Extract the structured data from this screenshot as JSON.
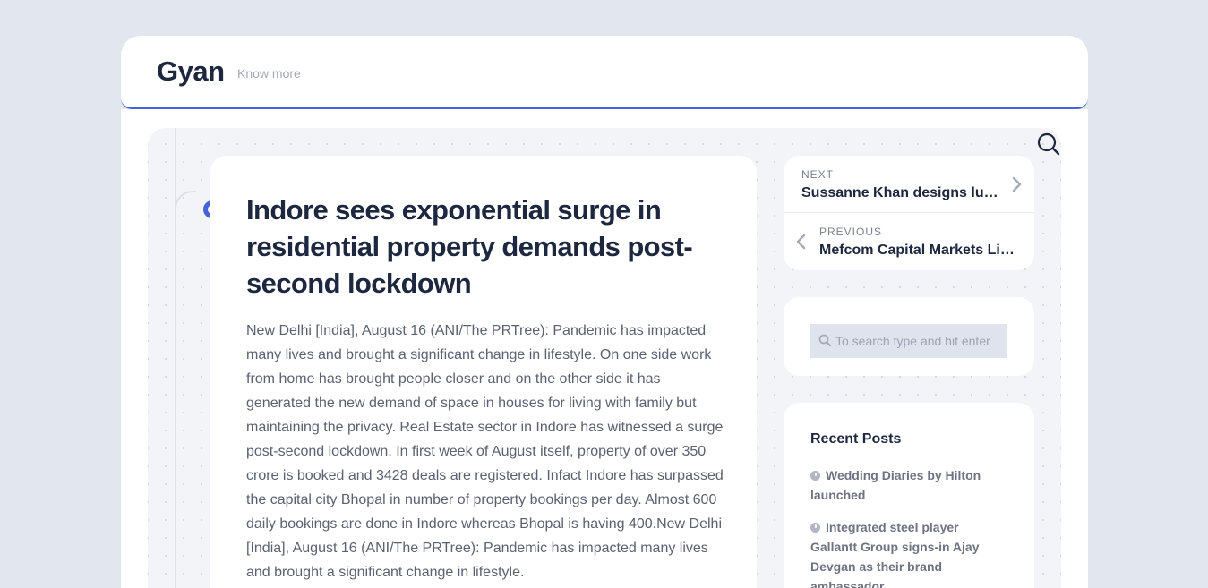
{
  "header": {
    "site_title": "Gyan",
    "tagline": "Know more"
  },
  "article": {
    "title": "Indore sees exponential surge in residential property demands post-second lockdown",
    "body": "New Delhi [India], August 16 (ANI/The PRTree): Pandemic has impacted many lives and brought a significant change in lifestyle. On one side work from home has brought people closer and on the other side it has generated the new demand of space in houses for living with family but maintaining the privacy. Real Estate sector in Indore has witnessed a surge post-second lockdown. In first week of August itself, property of over 350 crore is booked and 3428 deals are registered. Infact Indore has surpassed the capital city Bhopal in number of property bookings per day. Almost 600 daily bookings are done in Indore whereas Bhopal is having 400.New Delhi [India], August 16 (ANI/The PRTree): Pandemic has impacted many lives and brought a significant change in lifestyle."
  },
  "post_nav": {
    "next_kicker": "NEXT",
    "next_title": "Sussanne Khan designs luxury home",
    "prev_kicker": "PREVIOUS",
    "prev_title": "Mefcom Capital Markets Limited"
  },
  "search": {
    "placeholder": "To search type and hit enter"
  },
  "recent_posts": {
    "heading": "Recent Posts",
    "items": [
      "Wedding Diaries by Hilton launched",
      "Integrated steel player Gallantt Group signs-in Ajay Devgan as their brand ambassador"
    ]
  },
  "icons": {
    "search_toggle": "search-icon",
    "next_arrow": "chevron-right-icon",
    "prev_arrow": "chevron-left-icon",
    "search_box": "search-icon",
    "recent_item": "clock-icon"
  },
  "colors": {
    "accent": "#4465d8",
    "page_background": "#e2e6ee",
    "heading": "#1e2740",
    "body_text": "#5a6170"
  }
}
